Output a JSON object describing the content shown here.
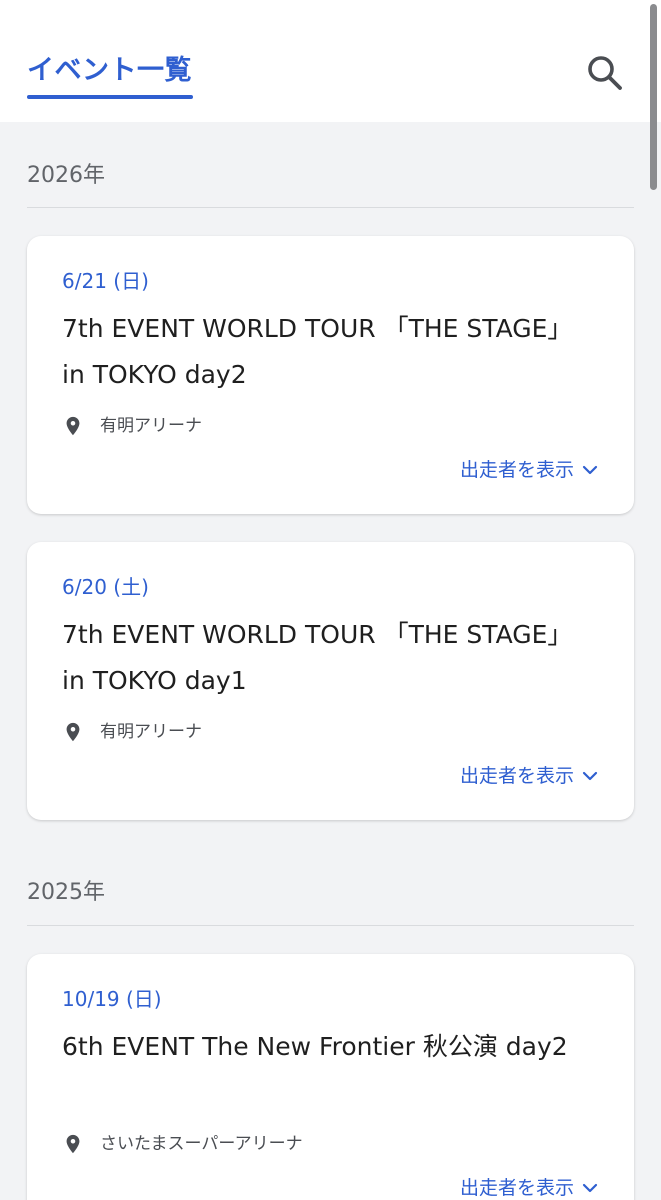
{
  "header": {
    "tab_label": "イベント一覧"
  },
  "colors": {
    "accent": "#2f5fd0",
    "background": "#f2f3f5"
  },
  "sections": [
    {
      "year": "2026年",
      "events": [
        {
          "date": "6/21 (日)",
          "title": "7th EVENT WORLD TOUR 「THE STAGE」 in TOKYO day2",
          "venue": "有明アリーナ",
          "more_label": "出走者を表示"
        },
        {
          "date": "6/20 (土)",
          "title": "7th EVENT WORLD TOUR 「THE STAGE」 in TOKYO day1",
          "venue": "有明アリーナ",
          "more_label": "出走者を表示"
        }
      ]
    },
    {
      "year": "2025年",
      "events": [
        {
          "date": "10/19 (日)",
          "title": "6th EVENT The New Frontier 秋公演 day2",
          "venue": "さいたまスーパーアリーナ",
          "more_label": "出走者を表示"
        }
      ]
    }
  ],
  "icons": {
    "search": "search-icon",
    "venue": "location-pin-icon",
    "expand": "chevron-down-icon"
  }
}
